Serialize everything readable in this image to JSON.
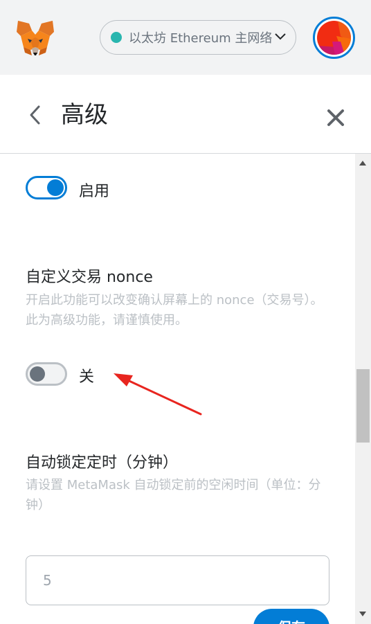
{
  "header": {
    "network_label": "以太坊 Ethereum 主网络",
    "network_color": "#29b6af"
  },
  "page": {
    "title": "高级"
  },
  "settings": {
    "enable_toggle": {
      "state": "on",
      "label": "启用"
    },
    "nonce": {
      "title": "自定义交易 nonce",
      "description": "开启此功能可以改变确认屏幕上的 nonce（交易号）。此为高级功能，请谨慎使用。",
      "toggle_state": "off",
      "toggle_label": "关"
    },
    "autolock": {
      "title": "自动锁定定时（分钟）",
      "description": "请设置 MetaMask 自动锁定前的空闲时间（单位：分钟）",
      "input_value": "5",
      "save_label": "保存"
    }
  },
  "colors": {
    "accent": "#037dd6",
    "annotation_arrow": "#e8251f"
  },
  "icons": [
    "metamask-fox-icon",
    "chevron-down-icon",
    "back-chevron-icon",
    "close-icon",
    "account-avatar-icon",
    "annotation-arrow-icon"
  ]
}
